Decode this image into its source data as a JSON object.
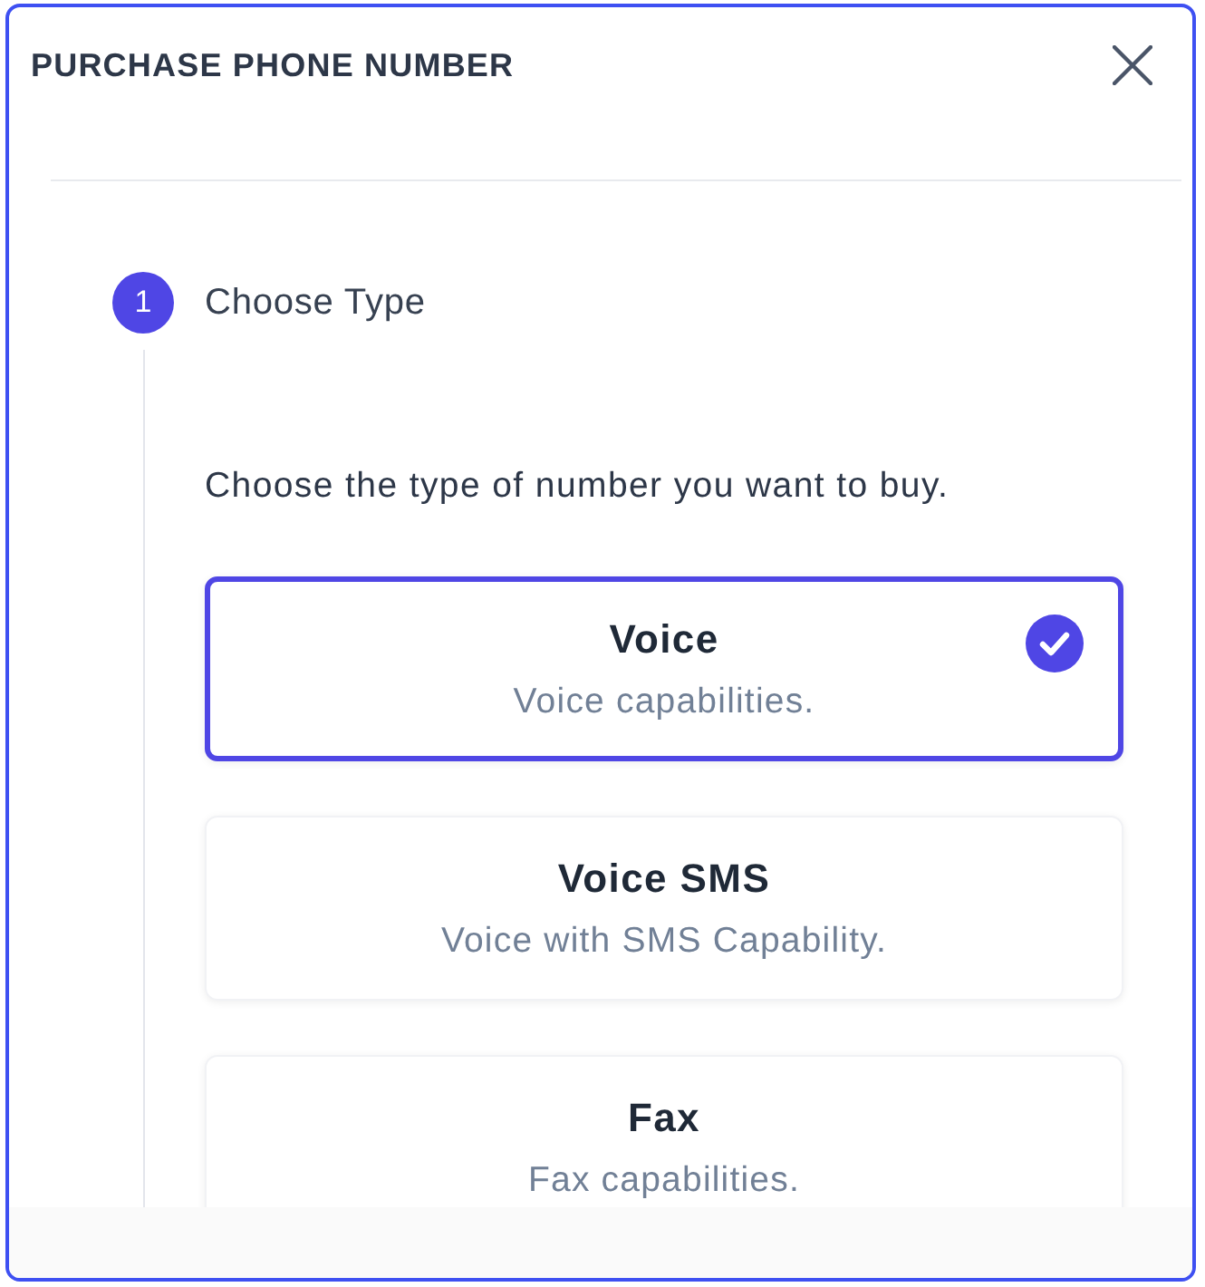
{
  "dialog": {
    "title": "PURCHASE PHONE NUMBER"
  },
  "steps": [
    {
      "number": "1",
      "label": "Choose Type",
      "active": true,
      "description": "Choose the type of number you want to buy.",
      "options": [
        {
          "title": "Voice",
          "subtitle": "Voice capabilities.",
          "selected": true
        },
        {
          "title": "Voice SMS",
          "subtitle": "Voice with SMS Capability.",
          "selected": false
        },
        {
          "title": "Fax",
          "subtitle": "Fax capabilities.",
          "selected": false
        }
      ]
    }
  ]
}
